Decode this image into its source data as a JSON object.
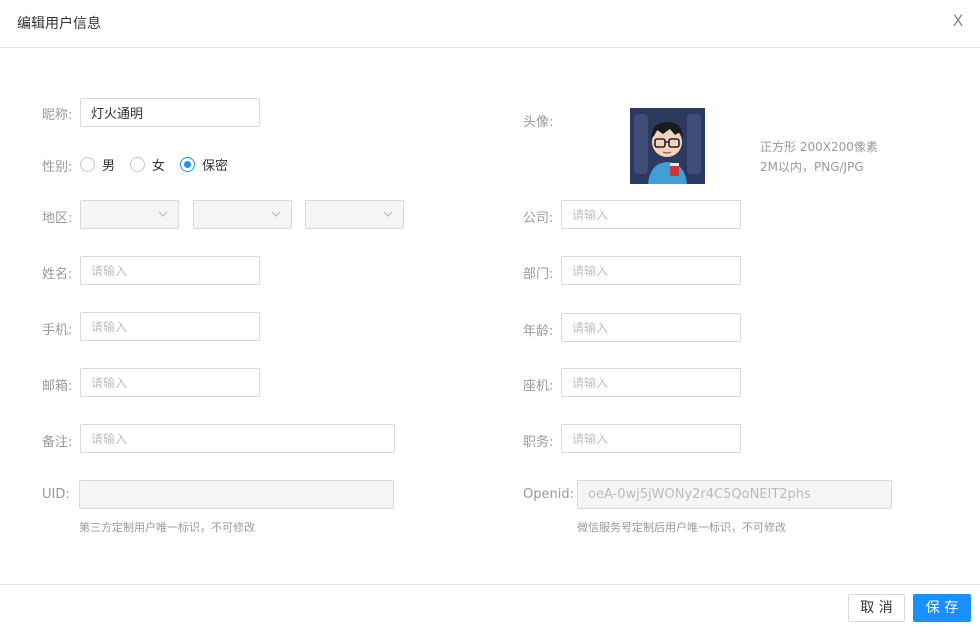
{
  "dialog": {
    "title": "编辑用户信息",
    "close_label": "X"
  },
  "form": {
    "nickname": {
      "label": "昵称:",
      "value": "灯火通明"
    },
    "gender": {
      "label": "性别:",
      "options": [
        "男",
        "女",
        "保密"
      ],
      "selected": "保密"
    },
    "region": {
      "label": "地区:"
    },
    "name": {
      "label": "姓名:",
      "placeholder": "请输入"
    },
    "phone": {
      "label": "手机:",
      "placeholder": "请输入"
    },
    "email": {
      "label": "邮箱:",
      "placeholder": "请输入"
    },
    "remark": {
      "label": "备注:",
      "placeholder": "请输入"
    },
    "uid": {
      "label": "UID:",
      "value": "",
      "hint": "第三方定制用户唯一标识，不可修改"
    },
    "avatar": {
      "label": "头像:",
      "tip_line1": "正方形 200X200像素",
      "tip_line2": "2M以内，PNG/JPG"
    },
    "company": {
      "label": "公司:",
      "placeholder": "请输入"
    },
    "department": {
      "label": "部门:",
      "placeholder": "请输入"
    },
    "age": {
      "label": "年龄:",
      "placeholder": "请输入"
    },
    "landline": {
      "label": "座机:",
      "placeholder": "请输入"
    },
    "position": {
      "label": "职务:",
      "placeholder": "请输入"
    },
    "openid": {
      "label": "Openid:",
      "value": "oeA-0wj5jWONy2r4C5QoNEIT2phs",
      "hint": "微信服务号定制后用户唯一标识，不可修改"
    }
  },
  "footer": {
    "cancel_label": "取 消",
    "save_label": "保 存"
  },
  "colors": {
    "accent": "#1890ff",
    "label": "#999999",
    "border": "#d9d9d9",
    "disabled_bg": "#f5f5f5"
  }
}
